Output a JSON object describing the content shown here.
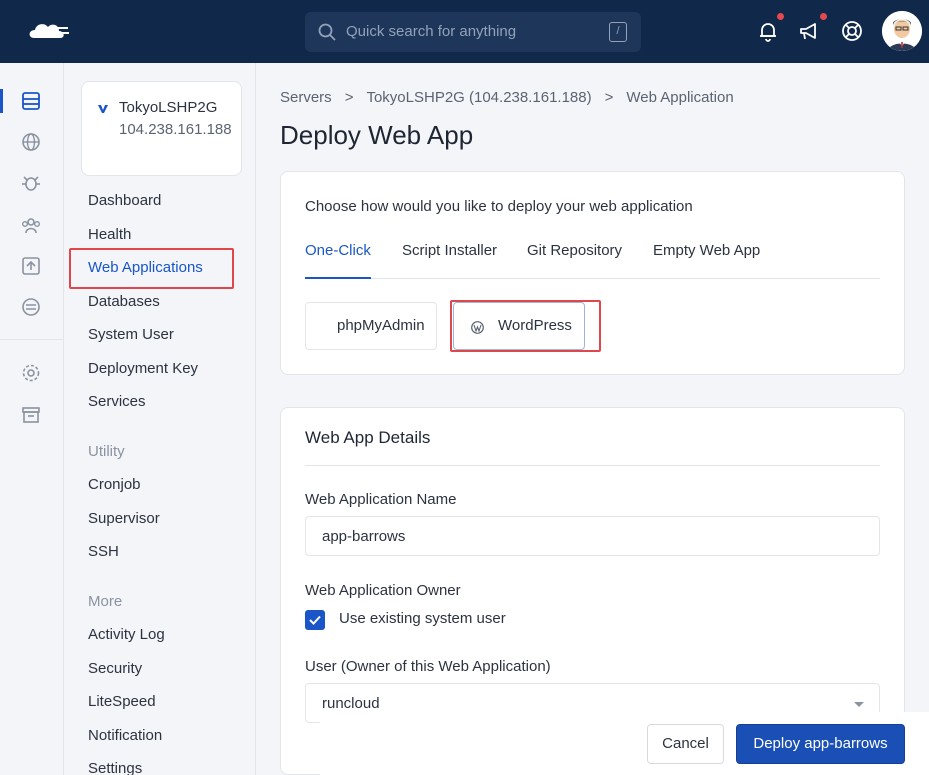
{
  "topbar": {
    "search_placeholder": "Quick search for anything",
    "search_shortcut": "/"
  },
  "server": {
    "name": "TokyoLSHP2G",
    "ip": "104.238.161.188"
  },
  "sidebar": {
    "items": [
      {
        "label": "Dashboard"
      },
      {
        "label": "Health"
      },
      {
        "label": "Web Applications",
        "active": true
      },
      {
        "label": "Databases"
      },
      {
        "label": "System User"
      },
      {
        "label": "Deployment Key"
      },
      {
        "label": "Services"
      }
    ],
    "utility_heading": "Utility",
    "utility_items": [
      {
        "label": "Cronjob"
      },
      {
        "label": "Supervisor"
      },
      {
        "label": "SSH"
      }
    ],
    "more_heading": "More",
    "more_items": [
      {
        "label": "Activity Log"
      },
      {
        "label": "Security"
      },
      {
        "label": "LiteSpeed"
      },
      {
        "label": "Notification"
      },
      {
        "label": "Settings"
      }
    ]
  },
  "breadcrumb": {
    "items": [
      "Servers",
      "TokyoLSHP2G (104.238.161.188)",
      "Web Application"
    ],
    "separator": ">"
  },
  "page": {
    "title": "Deploy Web App",
    "choose_text": "Choose how would you like to deploy your web application"
  },
  "tabs": [
    {
      "label": "One-Click",
      "active": true
    },
    {
      "label": "Script Installer"
    },
    {
      "label": "Git Repository"
    },
    {
      "label": "Empty Web App"
    }
  ],
  "one_click_apps": [
    {
      "label": "phpMyAdmin"
    },
    {
      "label": "WordPress",
      "selected": true
    }
  ],
  "details": {
    "title": "Web App Details",
    "name_label": "Web Application Name",
    "name_value": "app-barrows",
    "owner_label": "Web Application Owner",
    "use_existing_label": "Use existing system user",
    "use_existing_checked": true,
    "user_label": "User (Owner of this Web Application)",
    "user_value": "runcloud"
  },
  "footer": {
    "cancel_label": "Cancel",
    "deploy_label": "Deploy app-barrows"
  },
  "colors": {
    "topbar": "#10284a",
    "accent": "#1a56c7",
    "primary_button": "#1a4fb5",
    "highlight": "#e0474c",
    "notification_dot": "#e5484d"
  }
}
